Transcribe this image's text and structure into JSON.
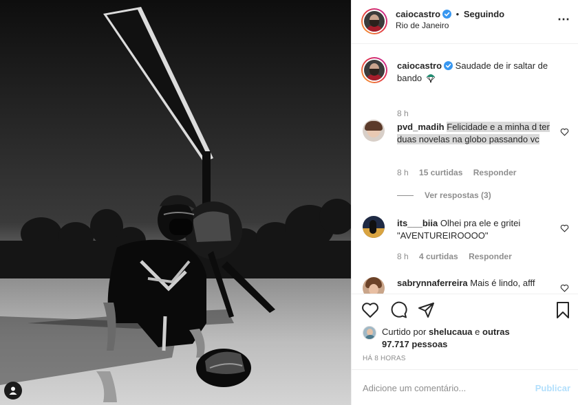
{
  "post": {
    "author": "caiocastro",
    "follow_status": "Seguindo",
    "location": "Rio de Janeiro",
    "more_icon": "⋯",
    "caption": "Saudade de ir saltar de bando",
    "caption_emoji": "parachute",
    "caption_time": "8 h"
  },
  "comments": [
    {
      "username": "pvd_madih",
      "text": "Felicidade e a minha d ter duas novelas na globo passando vc",
      "time": "8 h",
      "likes": "15 curtidas",
      "reply": "Responder",
      "view_replies": "Ver respostas (3)"
    },
    {
      "username": "its___biia",
      "text": "Olhei pra ele e gritei \"AVENTUREIROOOO\"",
      "time": "8 h",
      "likes": "4 curtidas",
      "reply": "Responder"
    },
    {
      "username": "sabrynnaferreira",
      "text": "Mais é lindo, afff"
    }
  ],
  "likes": {
    "prefix": "Curtido por",
    "user": "shelucaua",
    "conj": "e",
    "others": "outras 97.717 pessoas"
  },
  "timestamp": "HÁ 8 HORAS",
  "add_comment": {
    "placeholder": "Adicione um comentário...",
    "publish_label": "Publicar"
  },
  "colors": {
    "verified": "#3897f0",
    "publish_disabled": "#b2dffc",
    "muted": "#8e8e8e"
  }
}
